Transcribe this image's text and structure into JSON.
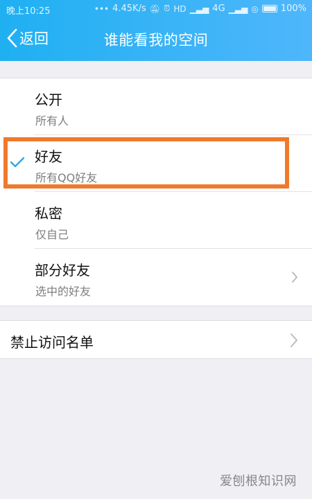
{
  "status_bar": {
    "time": "晚上10:25",
    "network_speed": "4.45K/s",
    "network_type": "4G",
    "battery": "100%"
  },
  "nav": {
    "back_label": "返回",
    "title": "谁能看我的空间"
  },
  "options": [
    {
      "title": "公开",
      "subtitle": "所有人",
      "selected": false
    },
    {
      "title": "好友",
      "subtitle": "所有QQ好友",
      "selected": true
    },
    {
      "title": "私密",
      "subtitle": "仅自己",
      "selected": false
    },
    {
      "title": "部分好友",
      "subtitle": "选中的好友",
      "selected": false
    }
  ],
  "blacklist": {
    "label": "禁止访问名单"
  },
  "watermark": "爱刨根知识网",
  "colors": {
    "header": "#3cb4f7",
    "check": "#2aa8e8",
    "highlight": "#f07a2b"
  }
}
